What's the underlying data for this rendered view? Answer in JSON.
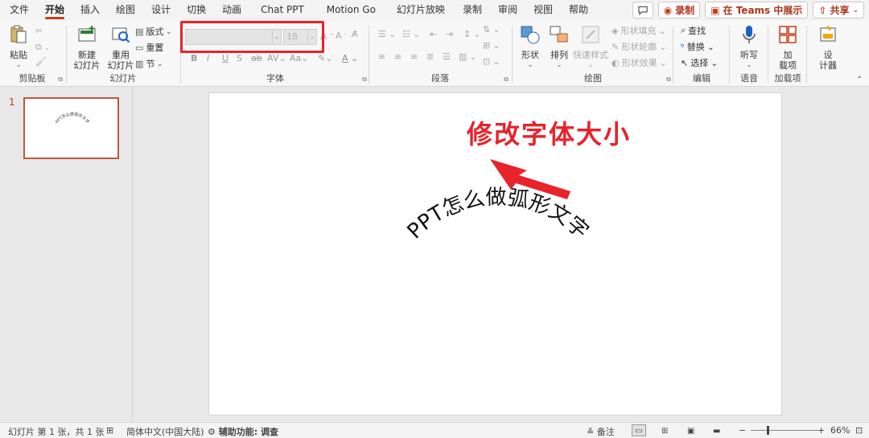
{
  "menu": {
    "tabs": [
      "文件",
      "开始",
      "插入",
      "绘图",
      "设计",
      "切换",
      "动画",
      "Chat PPT",
      "Motion Go",
      "幻灯片放映",
      "录制",
      "审阅",
      "视图",
      "帮助"
    ],
    "active_index": 1,
    "record_label": "录制",
    "teams_label": "在 Teams 中展示",
    "share_label": "共享"
  },
  "ribbon": {
    "clipboard": {
      "paste": "粘贴",
      "group": "剪贴板"
    },
    "slides": {
      "new_slide": "新建\n幻灯片",
      "new_slide_1": "新建",
      "new_slide_2": "幻灯片",
      "reuse_1": "重用",
      "reuse_2": "幻灯片",
      "layout": "版式",
      "reset": "重置",
      "section": "节",
      "group": "幻灯片"
    },
    "font": {
      "font_name": "",
      "font_size": "18",
      "group": "字体"
    },
    "paragraph": {
      "group": "段落"
    },
    "drawing": {
      "shape": "形状",
      "arrange": "排列",
      "quick_styles": "快速样式",
      "shape_fill": "形状填充",
      "shape_outline": "形状轮廓",
      "shape_effects": "形状效果",
      "group": "绘图"
    },
    "editing": {
      "find": "查找",
      "replace": "替换",
      "select": "选择",
      "group": "编辑"
    },
    "voice": {
      "dictate": "听写",
      "group": "语音"
    },
    "addins": {
      "addin_1": "加",
      "addin_2": "载项",
      "group": "加载项"
    },
    "designer": {
      "label_1": "设",
      "label_2": "计器"
    }
  },
  "slides_panel": {
    "thumb_number": "1"
  },
  "slide": {
    "arc_text": "PPT怎么做弧形文字"
  },
  "annotation": {
    "text": "修改字体大小",
    "color": "#e8232b"
  },
  "status": {
    "slide_info": "幻灯片 第 1 张，共 1 张",
    "language": "简体中文(中国大陆)",
    "accessibility": "辅助功能: 调查",
    "notes": "备注",
    "zoom": "66%"
  },
  "colors": {
    "accent": "#c43e1c",
    "highlight_red": "#e8232b"
  }
}
